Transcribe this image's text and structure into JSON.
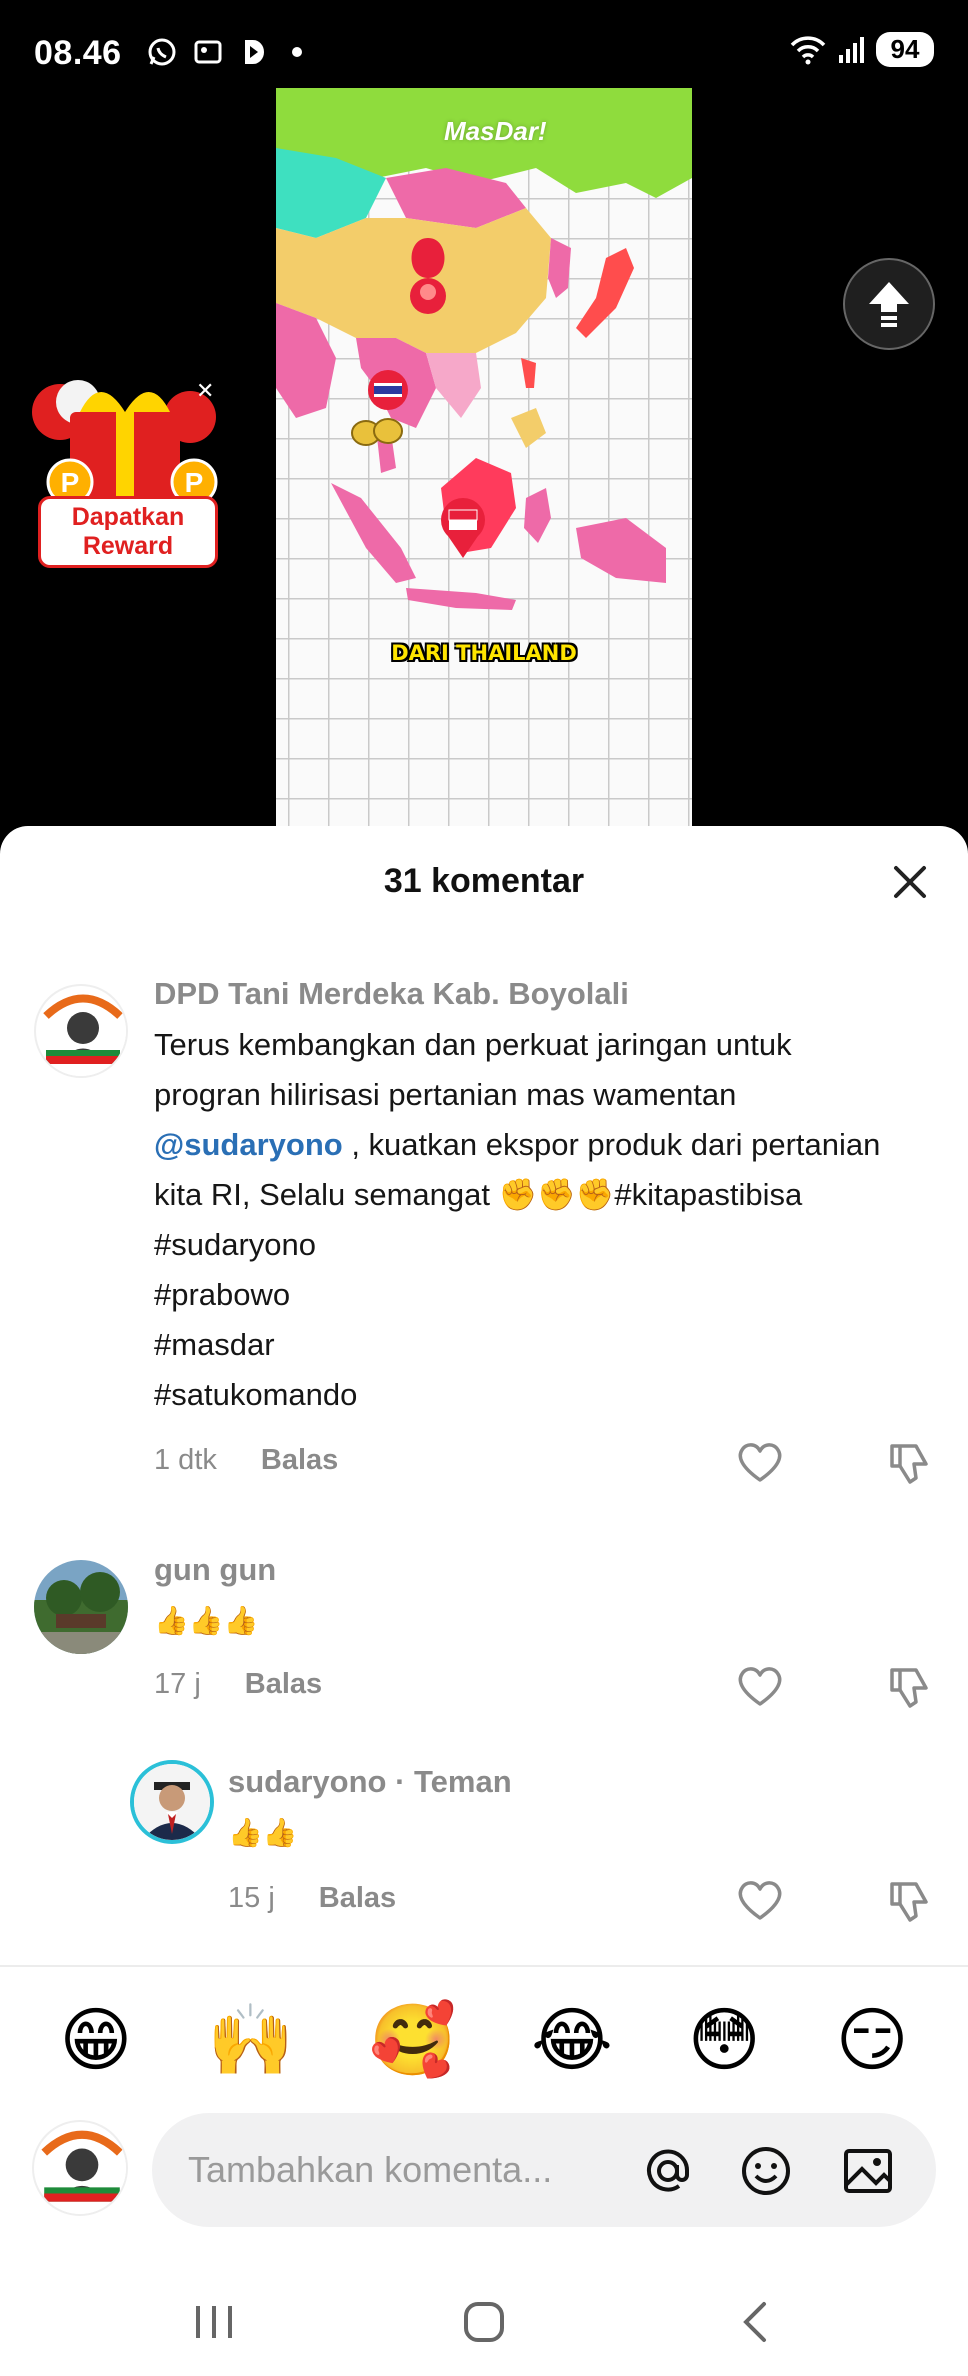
{
  "status_bar": {
    "time": "08.46",
    "battery": "94"
  },
  "video": {
    "caption": "DARI THAILAND",
    "logo": "MasDar!"
  },
  "reward": {
    "label": "Dapatkan Reward"
  },
  "sheet": {
    "title": "31 komentar"
  },
  "comments": [
    {
      "user": "DPD Tani Merdeka Kab. Boyolali",
      "text_line1": "Terus kembangkan dan perkuat jaringan untuk",
      "text_line2": "progran hilirisasi pertanian mas wamentan",
      "mention": "@sudaryono",
      "text_line3": " , kuatkan ekspor produk dari pertanian",
      "text_line4": "kita RI, Selalu semangat ✊✊✊#kitapastibisa",
      "text_line5": "#sudaryono",
      "text_line6": "#prabowo",
      "text_line7": "#masdar",
      "text_line8": "#satukomando",
      "time": "1 dtk",
      "reply": "Balas"
    },
    {
      "user": "gun gun",
      "text": "👍👍👍",
      "time": "17 j",
      "reply": "Balas"
    },
    {
      "user": "sudaryono · Teman",
      "text": "👍👍",
      "time": "15 j",
      "reply": "Balas"
    }
  ],
  "emoji_bar": [
    "😁",
    "🙌",
    "🥰",
    "😂",
    "😳",
    "😏"
  ],
  "input": {
    "placeholder": "Tambahkan komenta..."
  },
  "colors": {
    "accent_link": "#2a6fb5",
    "reward_red": "#e02020",
    "caption_yellow": "#ffe500"
  }
}
